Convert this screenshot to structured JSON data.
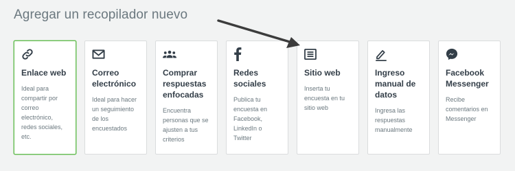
{
  "page": {
    "title": "Agregar un recopilador nuevo"
  },
  "colors": {
    "selected_border": "#6bbf59",
    "text_dark": "#333e48",
    "text_muted": "#6b787f"
  },
  "collectors": [
    {
      "icon": "link-icon",
      "title_lines": [
        "Enlace web"
      ],
      "desc_lines": [
        "Ideal para",
        "compartir por",
        "correo",
        "electrónico,",
        "redes sociales,",
        "etc."
      ]
    },
    {
      "icon": "email-icon",
      "title_lines": [
        "Correo",
        "electrónico"
      ],
      "desc_lines": [
        "Ideal para hacer",
        "un seguimiento",
        "de los",
        "encuestados"
      ]
    },
    {
      "icon": "people-icon",
      "title_lines": [
        "Comprar",
        "respuestas",
        "enfocadas"
      ],
      "desc_lines": [
        "Encuentra",
        "personas que se",
        "ajusten a tus",
        "criterios"
      ]
    },
    {
      "icon": "facebook-icon",
      "title_lines": [
        "Redes",
        "sociales"
      ],
      "desc_lines": [
        "Publica tu",
        "encuesta en",
        "Facebook,",
        "LinkedIn o",
        "Twitter"
      ]
    },
    {
      "icon": "website-icon",
      "title_lines": [
        "Sitio web"
      ],
      "desc_lines": [
        "Inserta tu",
        "encuesta en tu",
        "sitio web"
      ]
    },
    {
      "icon": "pencil-icon",
      "title_lines": [
        "Ingreso",
        "manual de",
        "datos"
      ],
      "desc_lines": [
        "Ingresa las",
        "respuestas",
        "manualmente"
      ]
    },
    {
      "icon": "messenger-icon",
      "title_lines": [
        "Facebook",
        "Messenger"
      ],
      "desc_lines": [
        "Recibe",
        "comentarios en",
        "Messenger"
      ]
    }
  ]
}
